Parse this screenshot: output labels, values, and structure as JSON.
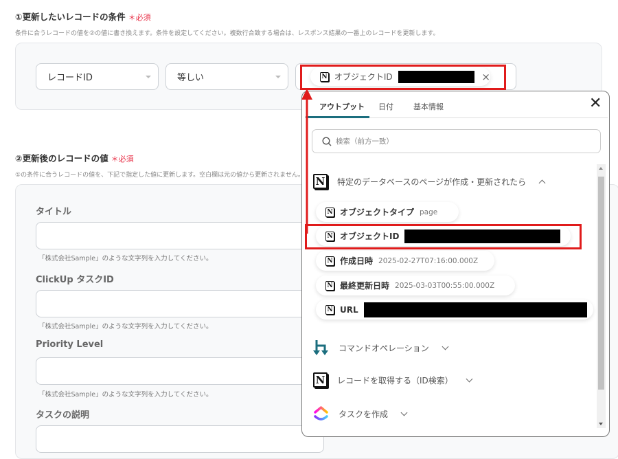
{
  "section1": {
    "title": "①更新したいレコードの条件",
    "required": "＊必須",
    "description": "条件に合うレコードの値を②の値に書き換えます。条件を設定してください。複数行合致する場合は、レスポンス結果の一番上のレコードを更新します。",
    "field_select": "レコードID",
    "operator_select": "等しい",
    "value_chip": {
      "label": "オブジェクトID",
      "icon": "notion-icon"
    }
  },
  "section2": {
    "title": "②更新後のレコードの値",
    "required": "＊必須",
    "description": "①の条件に合うレコードの値を、下記で指定した値に更新します。空白欄は元の値から更新されません。",
    "fields": [
      {
        "label": "タイトル",
        "hint": "「株式会社Sample」のような文字列を入力してください。"
      },
      {
        "label": "ClickUp タスクID",
        "hint": "「株式会社Sample」のような文字列を入力してください。"
      },
      {
        "label": "Priority Level",
        "hint": "「株式会社Sample」のような文字列を入力してください。"
      },
      {
        "label": "タスクの説明"
      }
    ]
  },
  "popup": {
    "tabs": [
      "アウトプット",
      "日付",
      "基本情報"
    ],
    "active_tab": "アウトプット",
    "search_placeholder": "検索（前方一致）",
    "sections": [
      {
        "title": "特定のデータベースのページが作成・更新されたら",
        "icon": "notion-icon",
        "expanded": true
      },
      {
        "title": "コマンドオペレーション",
        "icon": "command-operation-icon",
        "expanded": false
      },
      {
        "title": "レコードを取得する（ID検索）",
        "icon": "notion-icon",
        "expanded": false
      },
      {
        "title": "タスクを作成",
        "icon": "clickup-icon",
        "expanded": false
      }
    ],
    "items": [
      {
        "label": "オブジェクトタイプ",
        "value": "page"
      },
      {
        "label": "オブジェクトID"
      },
      {
        "label": "作成日時",
        "value": "2025-02-27T07:16:00.000Z"
      },
      {
        "label": "最終更新日時",
        "value": "2025-03-03T00:55:00.000Z"
      },
      {
        "label": "URL"
      }
    ]
  },
  "colors": {
    "accent": "#1b6e7e",
    "required": "#e8334a",
    "highlight": "#e01b1b"
  }
}
